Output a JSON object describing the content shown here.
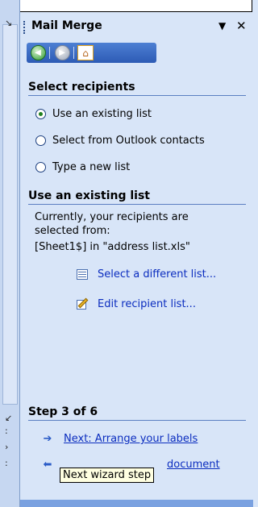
{
  "pane": {
    "title": "Mail Merge",
    "icons": {
      "dropdown": "triangle-down-icon",
      "close": "x-close-icon"
    }
  },
  "nav": {
    "back_icon": "back-arrow-icon",
    "forward_icon": "forward-arrow-icon",
    "home_icon": "home-icon"
  },
  "select_recipients": {
    "heading": "Select recipients",
    "options": [
      {
        "label": "Use an existing list",
        "checked": true
      },
      {
        "label": "Select from Outlook contacts",
        "checked": false
      },
      {
        "label": "Type a new list",
        "checked": false
      }
    ]
  },
  "existing_list": {
    "heading": "Use an existing list",
    "description": "Currently, your recipients are selected from:",
    "source": "[Sheet1$] in \"address list.xls\"",
    "select_link": "Select a different list...",
    "edit_link": "Edit recipient list..."
  },
  "step": {
    "heading": "Step 3 of 6",
    "next_link": "Next: Arrange your labels",
    "prev_link_visible": "document"
  },
  "tooltip": {
    "text": "Next wizard step"
  },
  "colors": {
    "pane_bg": "#d8e5f8",
    "link": "#0b2dbf",
    "nav_bar": "#2d5bb5"
  }
}
